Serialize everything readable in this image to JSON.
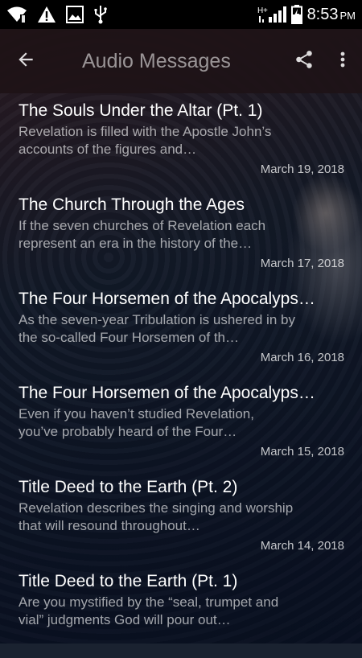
{
  "status_bar": {
    "time": "8:53",
    "ampm": "PM",
    "icons": [
      "wifi-icon",
      "warning-icon",
      "image-icon",
      "usb-icon",
      "signal-icon",
      "battery-charging-icon"
    ]
  },
  "app_bar": {
    "title": "Audio Messages",
    "back_icon": "arrow-back-icon",
    "share_icon": "share-icon",
    "more_icon": "more-vert-icon"
  },
  "messages": [
    {
      "title": "The Souls Under the Altar (Pt. 1)",
      "description": "Revelation is filled with the Apostle John’s accounts of the figures and…",
      "date": "March 19, 2018"
    },
    {
      "title": "The Church Through the Ages",
      "description": "If the seven churches of Revelation each represent an era in the history of the…",
      "date": "March 17, 2018"
    },
    {
      "title": "The Four Horsemen of the Apocalyps…",
      "description": "As the seven-year Tribulation is ushered in by the so-called Four Horsemen of th…",
      "date": "March 16, 2018"
    },
    {
      "title": "The Four Horsemen of the Apocalyps…",
      "description": "Even if you haven’t studied Revelation, you’ve probably heard of the Four…",
      "date": "March 15, 2018"
    },
    {
      "title": "Title Deed to the Earth (Pt. 2)",
      "description": "Revelation describes the singing and worship that will resound throughout…",
      "date": "March 14, 2018"
    },
    {
      "title": "Title Deed to the Earth (Pt. 1)",
      "description": "Are you mystified by the “seal, trumpet and vial” judgments God will pour out…",
      "date": ""
    }
  ]
}
